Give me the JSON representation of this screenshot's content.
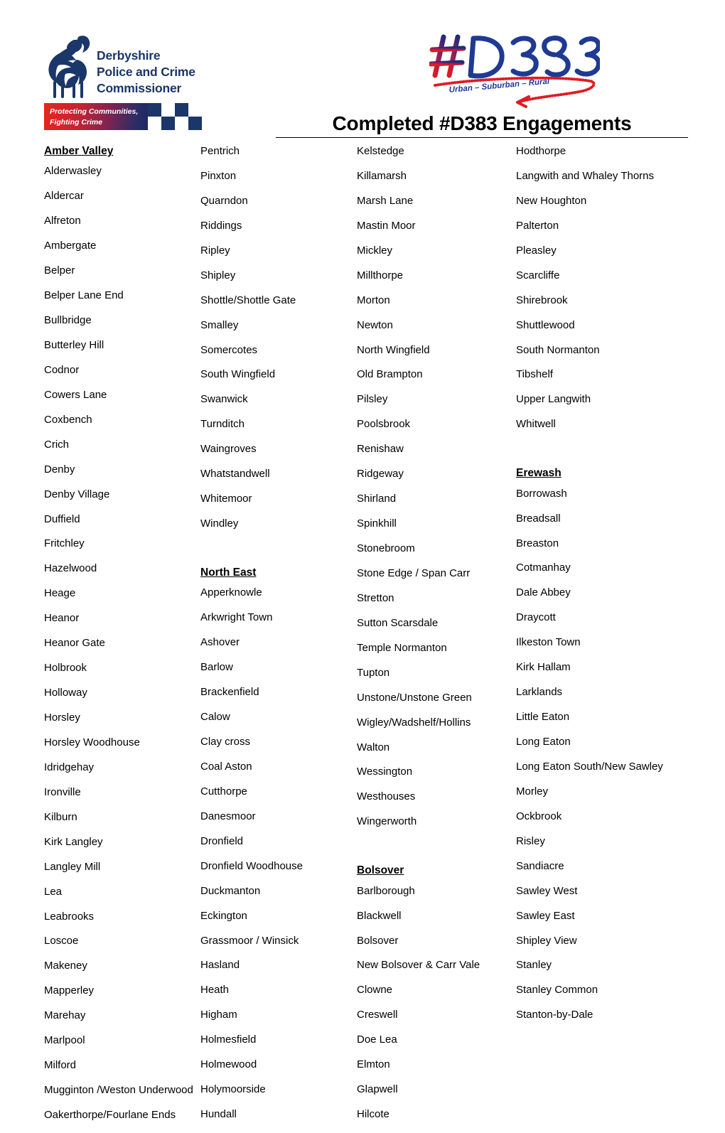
{
  "header": {
    "pcc_logo": {
      "line1": "Derbyshire",
      "line2": "Police and Crime",
      "line3": "Commissioner",
      "strapline_line1": "Protecting Communities,",
      "strapline_line2": "Fighting Crime",
      "navy": "#1b3668",
      "red": "#e8251e"
    },
    "d383_logo": {
      "mark": "#D383",
      "tagline": "Urban – Suburban – Rural",
      "navy": "#1f3a93",
      "red": "#e01b22"
    },
    "title": "Completed #D383 Engagements"
  },
  "columns": [
    {
      "blocks": [
        {
          "type": "section",
          "heading": "Amber Valley",
          "entries": [
            "Alderwasley",
            "Aldercar",
            "Alfreton",
            "Ambergate",
            "Belper",
            "Belper Lane End",
            "Bullbridge",
            "Butterley Hill",
            "Codnor",
            "Cowers Lane",
            "Coxbench",
            "Crich",
            "Denby",
            "Denby Village",
            "Duffield",
            "Fritchley",
            "Hazelwood",
            "Heage",
            "Heanor",
            "Heanor Gate",
            "Holbrook",
            "Holloway",
            "Horsley",
            "Horsley Woodhouse",
            "Idridgehay",
            "Ironville",
            "Kilburn",
            "Kirk Langley",
            "Langley Mill",
            "Lea",
            "Leabrooks",
            "Loscoe",
            "Makeney",
            "Mapperley",
            "Marehay",
            "Marlpool",
            "Milford",
            "Mugginton /Weston Underwood",
            "Oakerthorpe/Fourlane Ends"
          ]
        }
      ]
    },
    {
      "blocks": [
        {
          "type": "continuation",
          "heading": "",
          "entries": [
            "Pentrich",
            "Pinxton",
            "Quarndon",
            "Riddings",
            "Ripley",
            "Shipley",
            "Shottle/Shottle Gate",
            "Smalley",
            "Somercotes",
            "South Wingfield",
            "Swanwick",
            "Turnditch",
            "Waingroves",
            "Whatstandwell",
            "Whitemoor",
            "Windley"
          ]
        },
        {
          "type": "section",
          "heading": "North East",
          "entries": [
            "Apperknowle",
            "Arkwright Town",
            "Ashover",
            "Barlow",
            "Brackenfield",
            "Calow",
            "Clay cross",
            "Coal Aston",
            "Cutthorpe",
            "Danesmoor",
            "Dronfield",
            "Dronfield Woodhouse",
            "Duckmanton",
            "Eckington",
            "Grassmoor / Winsick",
            "Hasland",
            "Heath",
            "Higham",
            "Holmesfield",
            "Holmewood",
            "Holymoorside",
            "Hundall"
          ]
        }
      ]
    },
    {
      "blocks": [
        {
          "type": "continuation",
          "heading": "",
          "entries": [
            "Kelstedge",
            "Killamarsh",
            "Marsh Lane",
            "Mastin Moor",
            "Mickley",
            "Millthorpe",
            "Morton",
            "Newton",
            "North Wingfield",
            "Old Brampton",
            "Pilsley",
            "Poolsbrook",
            "Renishaw",
            "Ridgeway",
            "Shirland",
            "Spinkhill",
            "Stonebroom",
            "Stone Edge / Span Carr",
            "Stretton",
            "Sutton Scarsdale",
            "Temple Normanton",
            "Tupton",
            "Unstone/Unstone Green",
            "Wigley/Wadshelf/Hollins",
            "Walton",
            "Wessington",
            "Westhouses",
            "Wingerworth"
          ]
        },
        {
          "type": "section",
          "heading": "Bolsover",
          "entries": [
            "Barlborough",
            "Blackwell",
            "Bolsover",
            "New Bolsover & Carr Vale",
            "Clowne",
            "Creswell",
            "Doe Lea",
            "Elmton",
            "Glapwell",
            "Hilcote"
          ]
        }
      ]
    },
    {
      "blocks": [
        {
          "type": "continuation",
          "heading": "",
          "entries": [
            "Hodthorpe",
            "Langwith and Whaley Thorns",
            "New Houghton",
            "Palterton",
            "Pleasley",
            "Scarcliffe",
            "Shirebrook",
            "Shuttlewood",
            "South Normanton",
            "Tibshelf",
            "Upper Langwith",
            "Whitwell"
          ]
        },
        {
          "type": "section",
          "heading": "Erewash",
          "entries": [
            "Borrowash",
            "Breadsall",
            "Breaston",
            "Cotmanhay",
            "Dale Abbey",
            "Draycott",
            "Ilkeston Town",
            "Kirk Hallam",
            "Larklands",
            "Little Eaton",
            "Long Eaton",
            "Long Eaton South/New Sawley",
            "Morley",
            "Ockbrook",
            "Risley",
            "Sandiacre",
            "Sawley West",
            "Sawley East",
            "Shipley View",
            "Stanley",
            "Stanley Common",
            "Stanton-by-Dale"
          ]
        }
      ]
    }
  ]
}
